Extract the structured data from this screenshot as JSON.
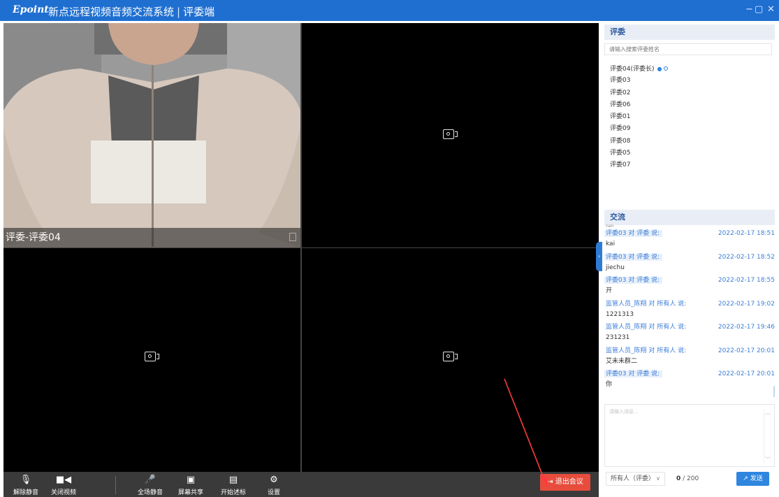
{
  "app": {
    "logo": "Epoint",
    "title": "新点远程视频音频交流系统",
    "subtitle": "评委端",
    "window_controls": {
      "minimize": "−",
      "maximize": "▢",
      "close": "✕"
    }
  },
  "video": {
    "tiles": [
      {
        "label": "评委-评委04",
        "has_video": true
      },
      {
        "label": "",
        "has_video": false
      },
      {
        "label": "",
        "has_video": false
      },
      {
        "label": "",
        "has_video": false
      }
    ]
  },
  "toolbar": {
    "unmute_label": "解除静音",
    "close_video_label": "关闭视频",
    "mute_all_label": "全场静音",
    "screen_share_label": "屏幕共享",
    "start_bid_label": "开始述标",
    "settings_label": "设置",
    "exit_label": "退出会议",
    "icons": {
      "unmute": "mic-off-icon",
      "video": "video-camera-icon",
      "mute_all": "mic-icon",
      "share": "monitor-icon",
      "bid": "chat-icon",
      "settings": "gear-icon",
      "exit": "exit-icon"
    }
  },
  "judges": {
    "header": "评委",
    "search_placeholder": "请输入搜索评委姓名",
    "items": [
      {
        "name": "评委04(评委长)",
        "leader": true
      },
      {
        "name": "评委03"
      },
      {
        "name": "评委02"
      },
      {
        "name": "评委06"
      },
      {
        "name": "评委01"
      },
      {
        "name": "评委09"
      },
      {
        "name": "评委08"
      },
      {
        "name": "评委05"
      },
      {
        "name": "评委07"
      }
    ]
  },
  "chat": {
    "header": "交流",
    "truncated_top": "nan",
    "messages": [
      {
        "sender": "评委03",
        "to": "对 评委 说:",
        "time": "2022-02-17 18:51",
        "body": "kai"
      },
      {
        "sender": "评委03",
        "to": "对 评委 说:",
        "time": "2022-02-17 18:52",
        "body": "jiechu"
      },
      {
        "sender": "评委03",
        "to": "对 评委 说:",
        "time": "2022-02-17 18:55",
        "body": "开"
      },
      {
        "sender": "监管人员_陈翔",
        "to": "对 所有人 说:",
        "time": "2022-02-17 19:02",
        "body": "1221313"
      },
      {
        "sender": "监管人员_陈翔",
        "to": "对 所有人 说:",
        "time": "2022-02-17 19:46",
        "body": "231231"
      },
      {
        "sender": "监管人员_陈翔",
        "to": "对 所有人 说:",
        "time": "2022-02-17 20:01",
        "body": "艾未未群二"
      },
      {
        "sender": "评委03",
        "to": "对 评委 说:",
        "time": "2022-02-17 20:01",
        "body": "你"
      }
    ],
    "input_placeholder": "请输入消息...",
    "recipient": "所有人（评委）",
    "count_current": "0",
    "count_max": "/ 200",
    "send_label": "发送"
  },
  "colors": {
    "titlebar": "#1f6fd1",
    "accent": "#2e86de",
    "exit": "#e74c3c",
    "annotation_arrow": "#ff3b3b"
  }
}
